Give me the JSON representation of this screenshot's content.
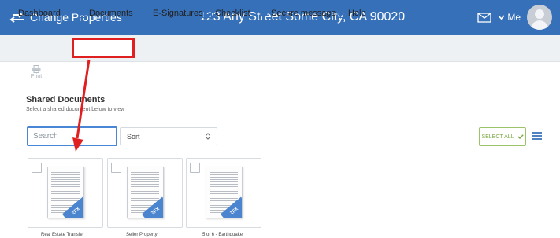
{
  "app": {
    "title": "Change Properties",
    "address": "123 Any Street Some City, CA 90020",
    "user_label": "Me"
  },
  "nav": {
    "items": [
      "Dashboard",
      "Documents",
      "E-Signatures",
      "Checklist",
      "Secure message",
      "Help"
    ]
  },
  "toolbar": {
    "print_label": "Print"
  },
  "shared": {
    "title": "Shared Documents",
    "subtitle": "Select a shared document below to view"
  },
  "controls": {
    "search_placeholder": "Search",
    "sort_label": "Sort",
    "select_all_label": "SELECT ALL"
  },
  "documents": [
    {
      "title": "Real Estate Transfer",
      "watermark": "ZFX"
    },
    {
      "title": "Seller Property",
      "watermark": "ZFX"
    },
    {
      "title": "5 of 6 - Earthquake",
      "watermark": "ZFX"
    }
  ],
  "colors": {
    "brand": "#3670b8",
    "highlight": "#e02020",
    "accent_green": "#7aa843"
  },
  "icons": [
    "swap-arrows-icon",
    "mail-icon",
    "chevron-down-icon",
    "avatar",
    "home-icon",
    "document-icon",
    "pen-icon",
    "calendar-icon",
    "shield-icon",
    "help-icon",
    "print-icon",
    "sort-arrows-icon",
    "check-icon",
    "list-view-icon"
  ]
}
